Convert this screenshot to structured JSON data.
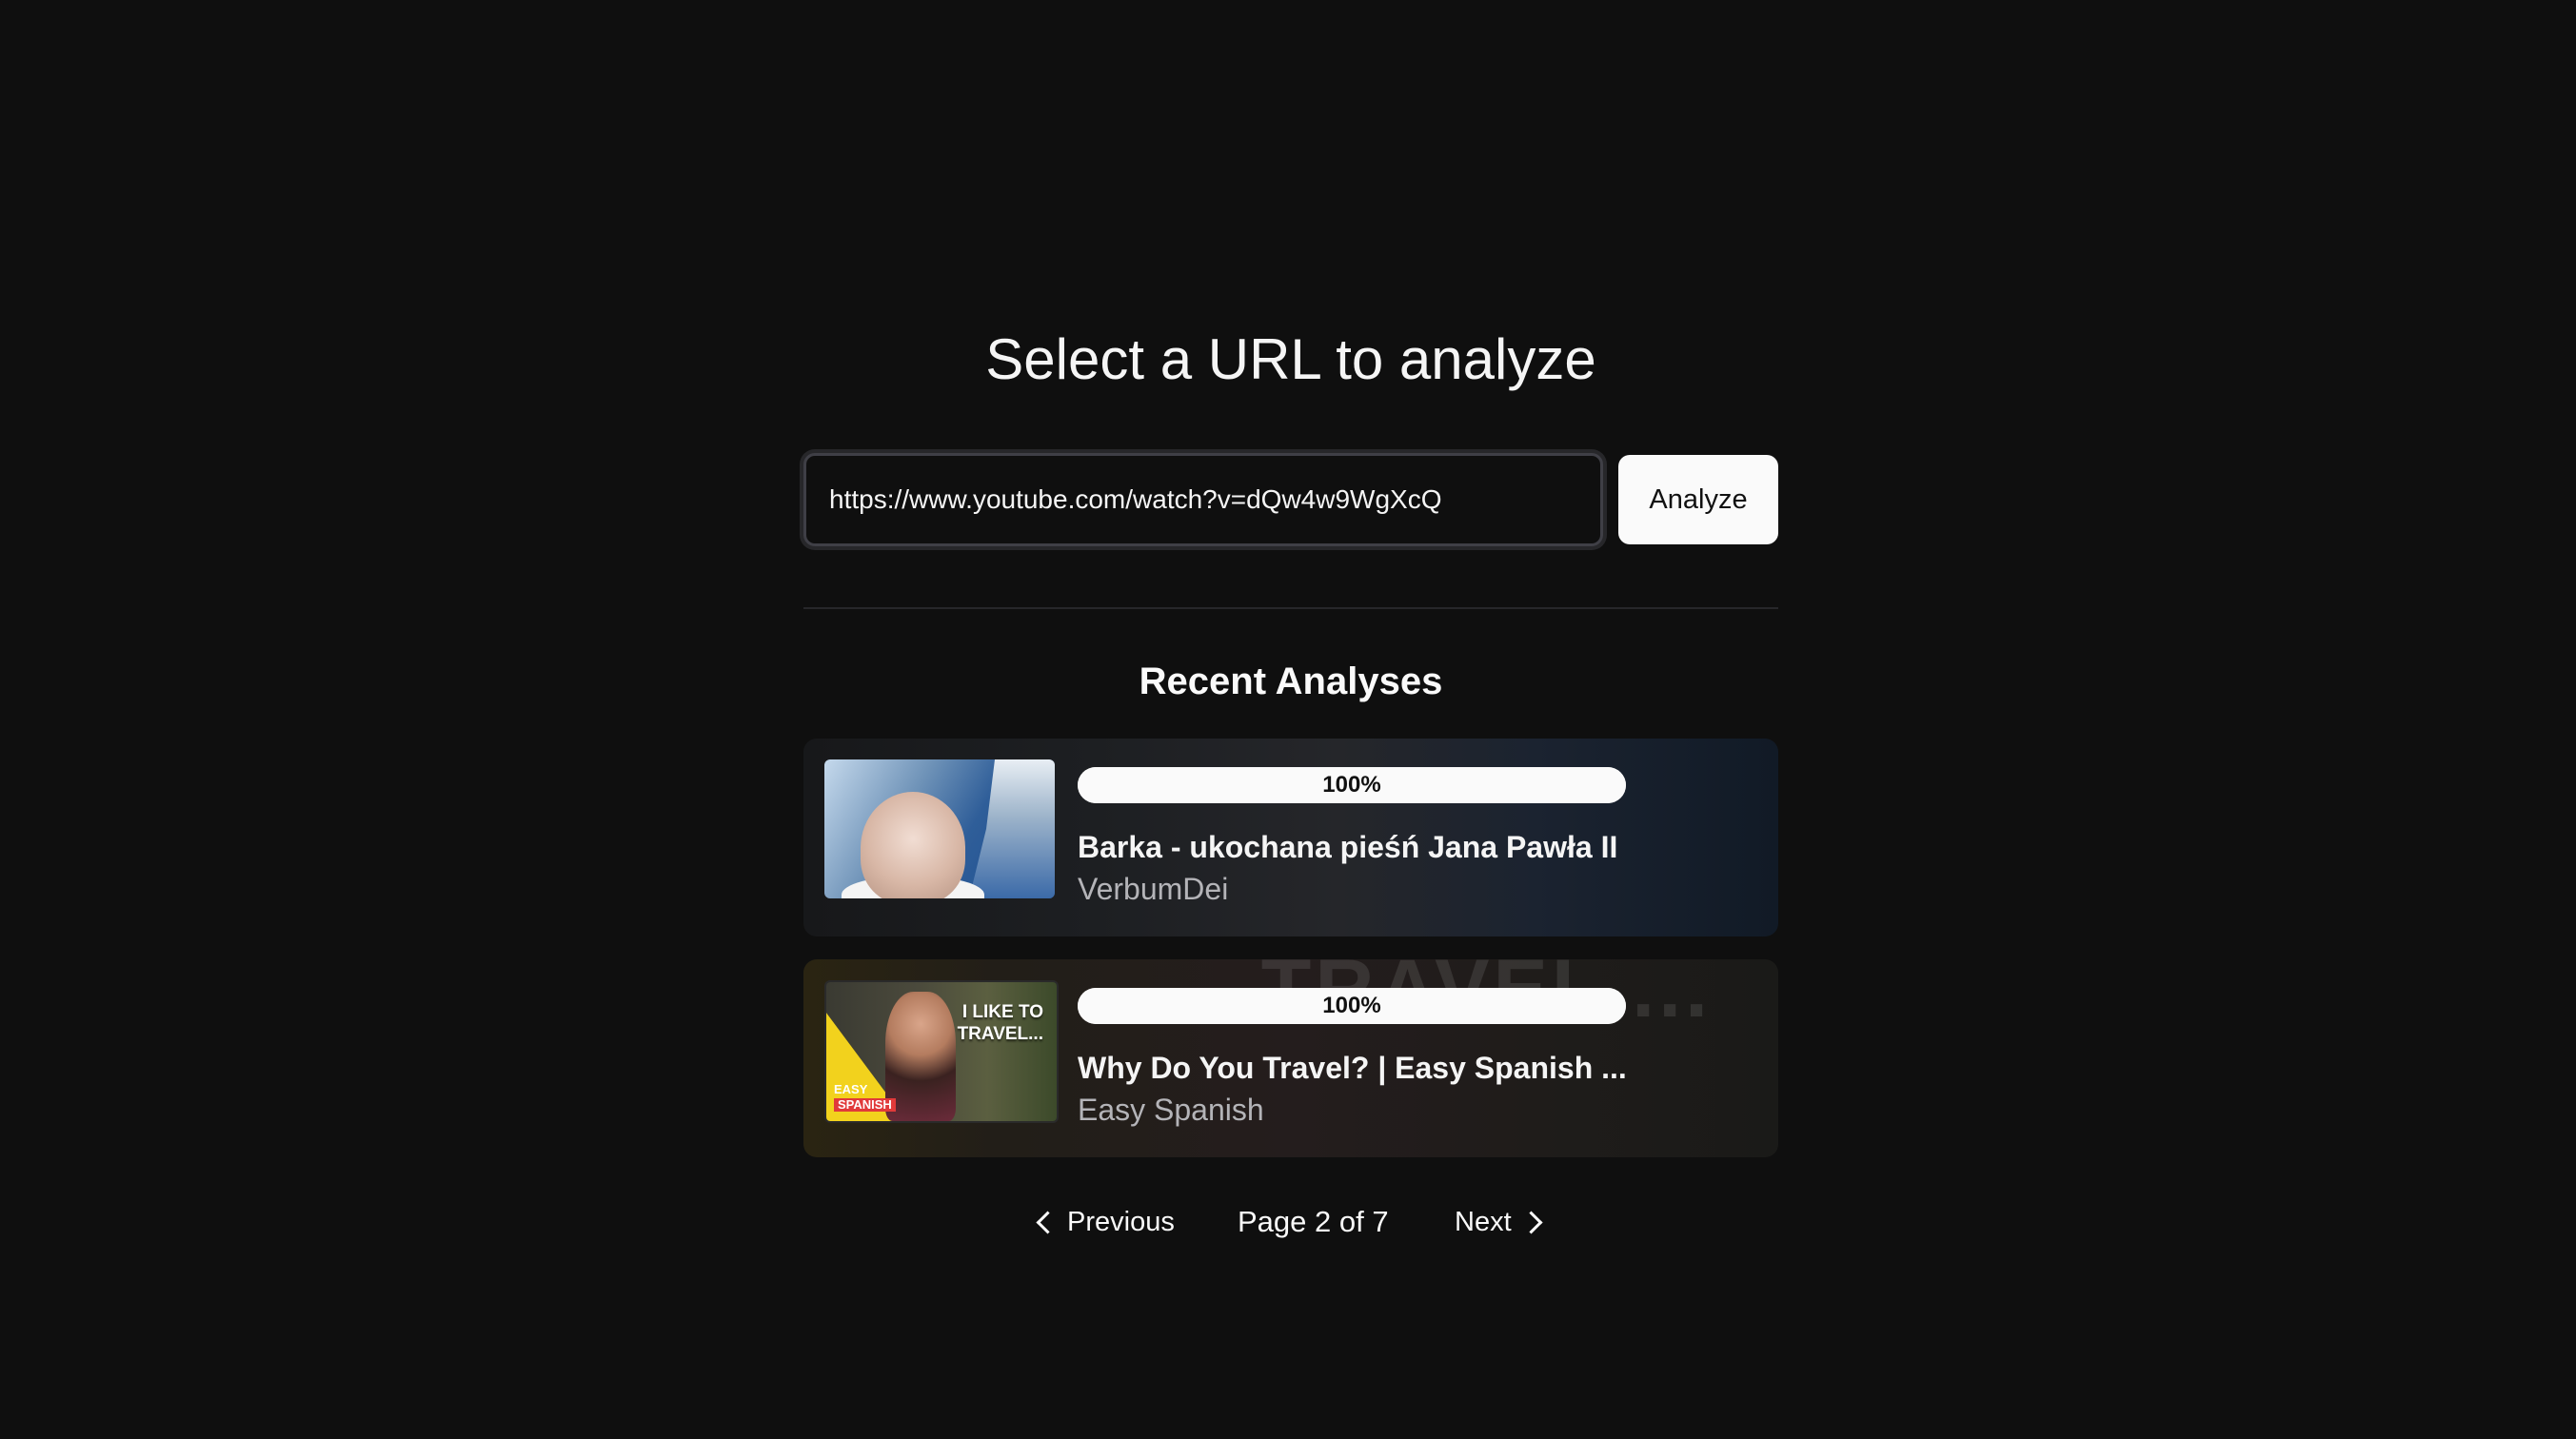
{
  "page_title": "Select a URL to analyze",
  "url_form": {
    "value": "https://www.youtube.com/watch?v=dQw4w9WgXcQ",
    "placeholder": "",
    "analyze_label": "Analyze"
  },
  "recent": {
    "title": "Recent Analyses",
    "items": [
      {
        "progress_percent": 100,
        "progress_label": "100%",
        "title": "Barka - ukochana pieśń Jana Pawła II",
        "channel": "VerbumDei"
      },
      {
        "progress_percent": 100,
        "progress_label": "100%",
        "title": "Why Do You Travel? | Easy Spanish ...",
        "channel": "Easy Spanish",
        "background_text": "TRAVEL....",
        "thumbnail_text": "I LIKE TO TRAVEL...",
        "thumbnail_logo": [
          "EASY",
          "SPANISH"
        ]
      }
    ]
  },
  "pagination": {
    "previous_label": "Previous",
    "page_info": "Page 2 of 7",
    "next_label": "Next"
  },
  "colors": {
    "background": "#0f0f0f",
    "primary_button": "#fafafa",
    "divider": "#27272a"
  }
}
